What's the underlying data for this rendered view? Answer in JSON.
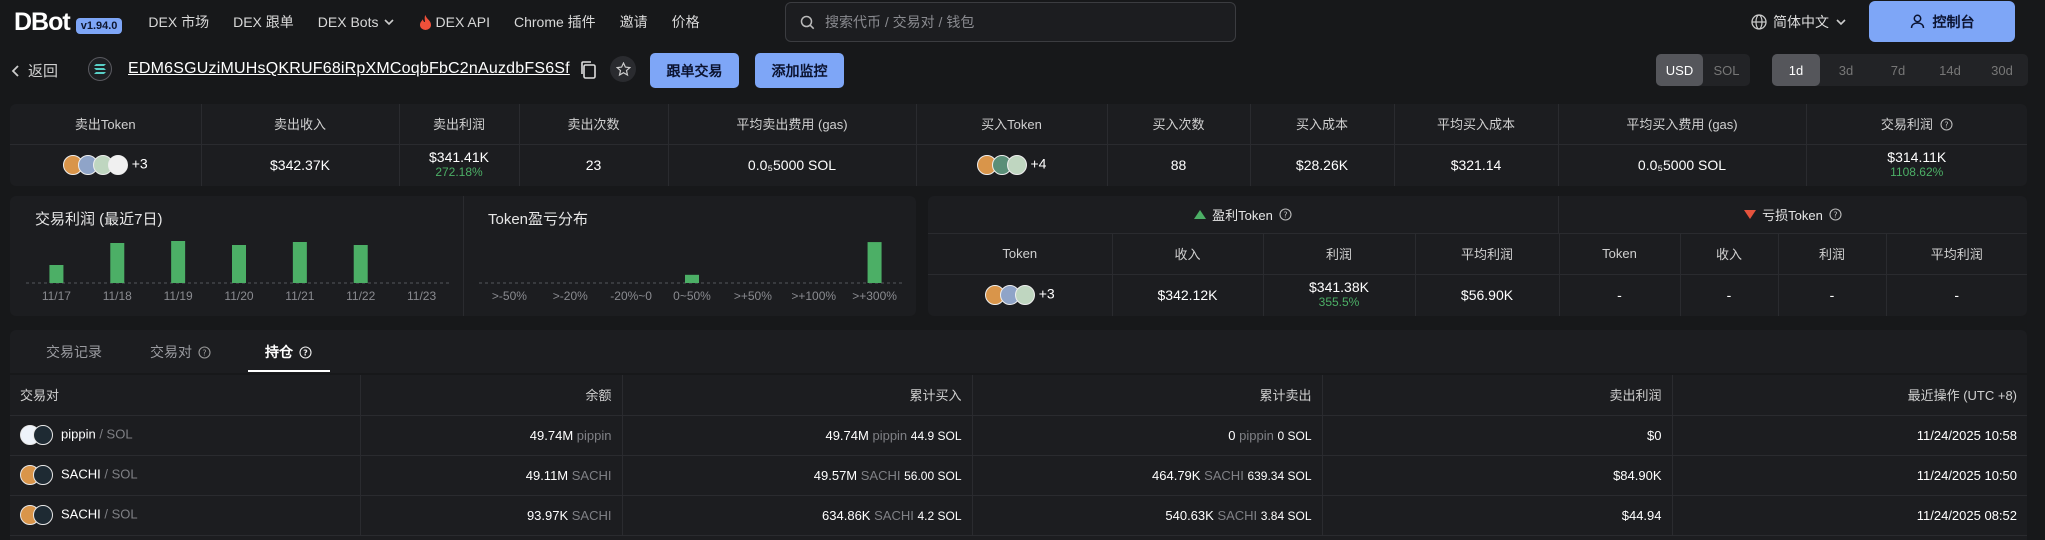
{
  "header": {
    "logo": "DBot",
    "version": "v1.94.0",
    "nav": [
      "DEX 市场",
      "DEX 跟单",
      "DEX Bots",
      "DEX API",
      "Chrome 插件",
      "邀请",
      "价格"
    ],
    "search_placeholder": "搜索代币 / 交易对 / 钱包",
    "language": "简体中文",
    "console_label": "控制台"
  },
  "subbar": {
    "back_label": "返回",
    "address": "EDM6SGUziMUHsQKRUF68iRpXMCoqbFbC2nAuzdbFS6Sf",
    "copy_trade_label": "跟单交易",
    "add_monitor_label": "添加监控",
    "currency": [
      "USD",
      "SOL"
    ],
    "currency_selected": "USD",
    "periods": [
      "1d",
      "3d",
      "7d",
      "14d",
      "30d"
    ],
    "period_selected": "1d"
  },
  "stats": {
    "headers": [
      "卖出Token",
      "卖出收入",
      "卖出利润",
      "卖出次数",
      "平均卖出费用 (gas)",
      "买入Token",
      "买入次数",
      "买入成本",
      "平均买入成本",
      "平均买入费用 (gas)",
      "交易利润"
    ],
    "sell_token_more": "+3",
    "sell_income": "$342.37K",
    "sell_profit": "$341.41K",
    "sell_profit_pct": "272.18%",
    "sell_count": "23",
    "avg_sell_fee": "0.0₅5000 SOL",
    "buy_token_more": "+4",
    "buy_count": "88",
    "buy_cost": "$28.26K",
    "avg_buy_cost": "$321.14",
    "avg_buy_fee": "0.0₅5000 SOL",
    "trade_profit": "$314.11K",
    "trade_profit_pct": "1108.62%"
  },
  "profit_chart": {
    "title": "交易利润 (最近7日)",
    "chart_data": {
      "type": "bar",
      "categories": [
        "11/17",
        "11/18",
        "11/19",
        "11/20",
        "11/21",
        "11/22",
        "11/23"
      ],
      "values": [
        18,
        40,
        42,
        38,
        41,
        38,
        0
      ],
      "ylim": [
        0,
        45
      ],
      "color": "#4caf66"
    }
  },
  "dist_chart": {
    "title": "Token盈亏分布",
    "chart_data": {
      "type": "bar",
      "categories": [
        ">-50%",
        ">-20%",
        "-20%~0",
        "0~50%",
        ">+50%",
        ">+100%",
        ">+300%"
      ],
      "values": [
        0,
        0,
        0,
        1,
        0,
        0,
        5
      ],
      "ylim": [
        0,
        5.5
      ],
      "color": "#4caf66"
    }
  },
  "pnl_tokens": {
    "profit_title": "盈利Token",
    "loss_title": "亏损Token",
    "profit_headers": [
      "Token",
      "收入",
      "利润",
      "平均利润"
    ],
    "loss_headers": [
      "Token",
      "收入",
      "利润",
      "平均利润"
    ],
    "profit_row": {
      "more": "+3",
      "income": "$342.12K",
      "profit": "$341.38K",
      "profit_pct": "355.5%",
      "avg_profit": "$56.90K"
    },
    "loss_row": [
      "-",
      "-",
      "-",
      "-"
    ]
  },
  "tabs": [
    "交易记录",
    "交易对",
    "持仓"
  ],
  "holdings": {
    "headers": [
      "交易对",
      "余额",
      "累计买入",
      "累计卖出",
      "卖出利润",
      "最近操作 (UTC +8)"
    ],
    "rows": [
      {
        "name": "pippin",
        "quote": "/ SOL",
        "balance": "49.74M",
        "balance_unit": "pippin",
        "buy_amt": "49.74M",
        "buy_unit": "pippin",
        "buy_sol": "44.9 SOL",
        "sell_amt": "0",
        "sell_unit": "pippin",
        "sell_sol": "0 SOL",
        "profit": "$0",
        "time": "11/24/2025 10:58"
      },
      {
        "name": "SACHI",
        "quote": "/ SOL",
        "balance": "49.11M",
        "balance_unit": "SACHI",
        "buy_amt": "49.57M",
        "buy_unit": "SACHI",
        "buy_sol": "56.00 SOL",
        "sell_amt": "464.79K",
        "sell_unit": "SACHI",
        "sell_sol": "639.34 SOL",
        "profit": "$84.90K",
        "time": "11/24/2025 10:50"
      },
      {
        "name": "SACHI",
        "quote": "/ SOL",
        "balance": "93.97K",
        "balance_unit": "SACHI",
        "buy_amt": "634.86K",
        "buy_unit": "SACHI",
        "buy_sol": "4.2 SOL",
        "sell_amt": "540.63K",
        "sell_unit": "SACHI",
        "sell_sol": "3.84 SOL",
        "profit": "$44.94",
        "time": "11/24/2025 08:52"
      }
    ]
  },
  "colors": {
    "accent": "#7ea6f7",
    "profit": "#4caf66",
    "loss": "#e5533d",
    "bg": "#17181a",
    "panel": "#1c1d20"
  }
}
